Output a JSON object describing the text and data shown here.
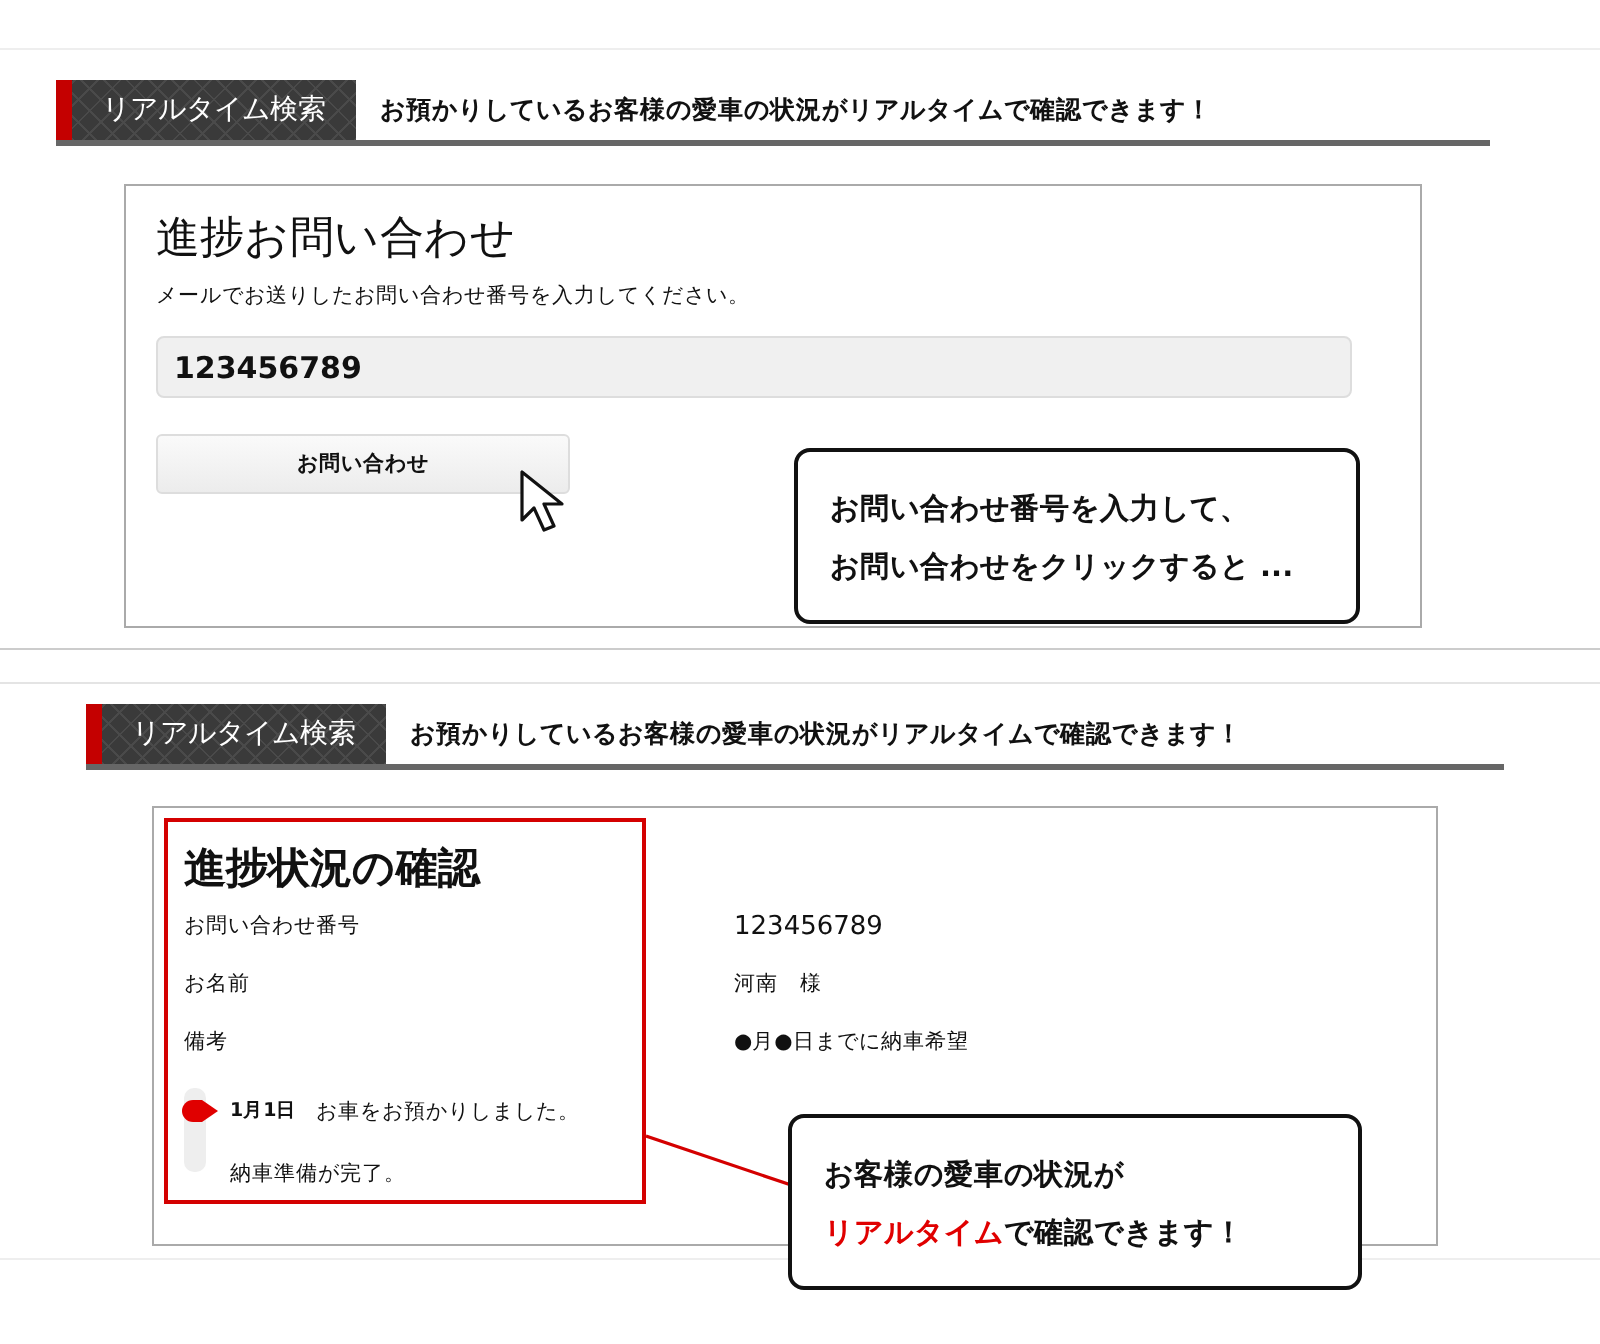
{
  "search_header_top": {
    "label": "リアルタイム検索",
    "text": "お預かりしているお客様の愛車の状況がリアルタイムで確認できます！"
  },
  "inquiry_form": {
    "title": "進捗お問い合わせ",
    "description": "メールでお送りしたお問い合わせ番号を入力してください。",
    "input": {
      "value": "123456789"
    },
    "button": "お問い合わせ",
    "callout": [
      "お問い合わせ番号を入力して、",
      "お問い合わせをクリックすると ..."
    ]
  },
  "search_header_bottom": {
    "label": "リアルタイム検索",
    "text": "お預かりしているお客様の愛車の状況がリアルタイムで確認できます！"
  },
  "progress_result": {
    "title": "進捗状況の確認",
    "rows": [
      {
        "label": "お問い合わせ番号",
        "value": "123456789"
      },
      {
        "label": "お名前",
        "value": "河南　様"
      },
      {
        "label": "備考",
        "value": "●月●日までに納車希望"
      }
    ],
    "timeline": [
      {
        "date": "1月1日",
        "text": "お車をお預かりしました。",
        "current": true
      },
      {
        "text": "納車準備が完了。",
        "current": false
      }
    ],
    "callout": [
      "お客様の愛車の状況が",
      "**リアルタイム**で確認できます！"
    ]
  }
}
